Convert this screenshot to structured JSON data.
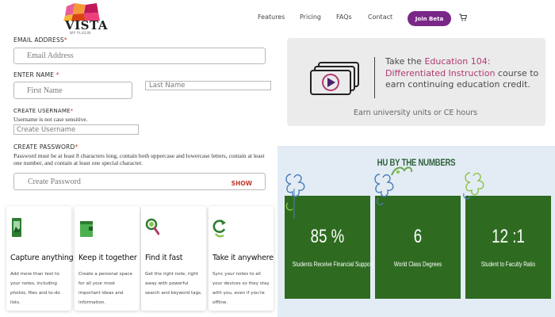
{
  "header": {
    "logo_text": "VISTA",
    "logo_sub": "WP PLUGIN",
    "nav": [
      "Features",
      "Pricing",
      "FAQs",
      "Contact"
    ],
    "join_label": "Join Beta",
    "cart_icon": "cart-icon"
  },
  "form": {
    "email_label": "EMAIL ADDRESS",
    "email_placeholder": "Email Address",
    "name_label": "ENTER NAME",
    "first_placeholder": "First Name",
    "last_placeholder": "Last Name",
    "username_label": "CREATE USERNAME",
    "username_hint": "Username is not case sensitive.",
    "username_placeholder": "Create Username",
    "password_label": "CREATE PASSWORD",
    "password_hint": "Password must be at least 8 characters long, contain both uppercase and lowercase letters, contain at least one number, and contain at least one special character.",
    "password_placeholder": "Create Password",
    "show_label": "SHOW",
    "required_mark": "*"
  },
  "promo": {
    "line_prefix": "Take the ",
    "course": "Education 104: Differentiated Instruction",
    "line_suffix": " course to earn continuing education credit.",
    "subtext": "Earn university units or CE hours",
    "icon": "video-course-icon"
  },
  "features": [
    {
      "title": "Capture anything",
      "desc": "Add more than text to your notes, including photos, files and to-do lists.",
      "icon": "capture-icon",
      "color": "#2e7d32"
    },
    {
      "title": "Keep it together",
      "desc": "Create a personal space for all your most important ideas and information.",
      "icon": "notebook-icon",
      "color": "#4caf50"
    },
    {
      "title": "Find it fast",
      "desc": "Get the right note, right away with powerful search and keyword tags.",
      "icon": "search-icon",
      "color": "#2e7d32"
    },
    {
      "title": "Take it anywhere",
      "desc": "Sync your notes to all your devices so they stay with you, even if you're offline.",
      "icon": "sync-icon",
      "color": "#2e7d32"
    }
  ],
  "stats": {
    "title": "HU BY THE NUMBERS",
    "items": [
      {
        "value": "85 %",
        "label": "Students Receive Financial Support"
      },
      {
        "value": "6",
        "label": "World Class Degrees"
      },
      {
        "value": "12 :1",
        "label": "Student to Faculty Ratio"
      }
    ],
    "accent": "#2e6b20"
  },
  "colors": {
    "brand": "#7a2888",
    "highlight": "#b03a6e",
    "required": "#c0392b"
  }
}
